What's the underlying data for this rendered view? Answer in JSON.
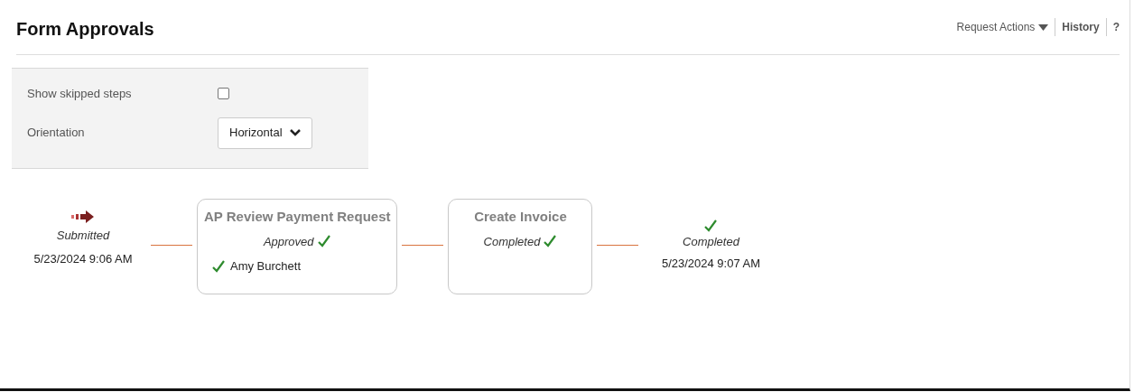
{
  "header": {
    "title": "Form Approvals",
    "actions": [
      {
        "kind": "dropdown",
        "label": "Request Actions"
      },
      {
        "kind": "link",
        "label": "History"
      },
      {
        "kind": "link",
        "label": "?"
      }
    ]
  },
  "options": [
    {
      "kind": "checkbox",
      "label": "Show skipped steps",
      "checked": false
    },
    {
      "kind": "select",
      "label": "Orientation",
      "value": "Horizontal"
    }
  ],
  "flow": [
    {
      "kind": "start",
      "status": "Submitted",
      "time": "5/23/2024 9:06 AM"
    },
    {
      "kind": "step",
      "title": "AP Review Payment Request",
      "status": "Approved",
      "approvers": [
        "Amy Burchett"
      ]
    },
    {
      "kind": "step",
      "title": "Create Invoice",
      "status": "Completed"
    },
    {
      "kind": "end",
      "status": "Completed",
      "time": "5/23/2024 9:07 AM"
    }
  ]
}
